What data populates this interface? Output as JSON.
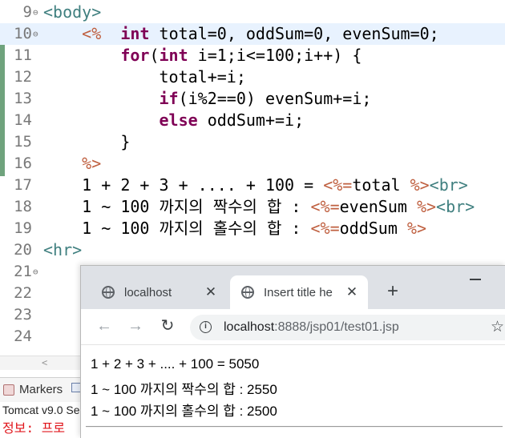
{
  "editor": {
    "lines": [
      {
        "num": "9",
        "fold": "⊖",
        "parts": [
          {
            "t": "<body>",
            "c": "tag"
          }
        ]
      },
      {
        "num": "10",
        "fold": "⊖",
        "current": true,
        "parts": [
          {
            "t": "    "
          },
          {
            "t": "<%",
            "c": "jsp"
          },
          {
            "t": "  "
          },
          {
            "t": "int",
            "c": "kw"
          },
          {
            "t": " total=0, oddSum=0, evenSum=0;"
          }
        ]
      },
      {
        "num": "11",
        "parts": [
          {
            "t": "        "
          },
          {
            "t": "for",
            "c": "kw"
          },
          {
            "t": "("
          },
          {
            "t": "int",
            "c": "kw"
          },
          {
            "t": " i=1;i<=100;i++) {"
          }
        ]
      },
      {
        "num": "12",
        "parts": [
          {
            "t": "            total+=i;"
          }
        ]
      },
      {
        "num": "13",
        "parts": [
          {
            "t": "            "
          },
          {
            "t": "if",
            "c": "kw"
          },
          {
            "t": "(i%2==0) evenSum+=i;"
          }
        ]
      },
      {
        "num": "14",
        "parts": [
          {
            "t": "            "
          },
          {
            "t": "else",
            "c": "kw"
          },
          {
            "t": " oddSum+=i;"
          }
        ]
      },
      {
        "num": "15",
        "parts": [
          {
            "t": "        }"
          }
        ]
      },
      {
        "num": "16",
        "parts": [
          {
            "t": "    "
          },
          {
            "t": "%>",
            "c": "jsp"
          }
        ]
      },
      {
        "num": "17",
        "parts": [
          {
            "t": "    1 + 2 + 3 + .... + 100 = "
          },
          {
            "t": "<%=",
            "c": "jsp"
          },
          {
            "t": "total "
          },
          {
            "t": "%>",
            "c": "jsp"
          },
          {
            "t": "<br>",
            "c": "tag"
          }
        ]
      },
      {
        "num": "18",
        "parts": [
          {
            "t": "    1 ~ 100 까지의 짝수의 합 : "
          },
          {
            "t": "<%=",
            "c": "jsp"
          },
          {
            "t": "evenSum "
          },
          {
            "t": "%>",
            "c": "jsp"
          },
          {
            "t": "<br>",
            "c": "tag"
          }
        ]
      },
      {
        "num": "19",
        "parts": [
          {
            "t": "    1 ~ 100 까지의 홀수의 합 : "
          },
          {
            "t": "<%=",
            "c": "jsp"
          },
          {
            "t": "oddSum "
          },
          {
            "t": "%>",
            "c": "jsp"
          }
        ]
      },
      {
        "num": "20",
        "parts": [
          {
            "t": "<hr>",
            "c": "tag"
          }
        ]
      },
      {
        "num": "21",
        "fold": "⊖",
        "parts": []
      },
      {
        "num": "22",
        "parts": []
      },
      {
        "num": "23",
        "parts": []
      },
      {
        "num": "24",
        "parts": []
      }
    ],
    "colors": {
      "tag": "#3f7f7f",
      "jsp": "#bf5f3f",
      "keyword": "#7f0055"
    }
  },
  "panel": {
    "tabs": [
      {
        "label": "Markers",
        "icon": "markers-icon"
      },
      {
        "label": "",
        "icon": "properties-icon"
      }
    ],
    "console_header": "Tomcat v9.0 Se",
    "console_line": "정보:  프로"
  },
  "browser": {
    "tabs": [
      {
        "title": "localhost",
        "active": false
      },
      {
        "title": "Insert title he",
        "active": true
      }
    ],
    "new_tab": "+",
    "url_host": "localhost",
    "url_rest": ":8888/jsp01/test01.jsp",
    "output": [
      "1 + 2 + 3 + .... + 100 = 5050",
      "1 ~ 100 까지의 짝수의 합 : 2550",
      "1 ~ 100 까지의 홀수의 합 : 2500"
    ]
  }
}
